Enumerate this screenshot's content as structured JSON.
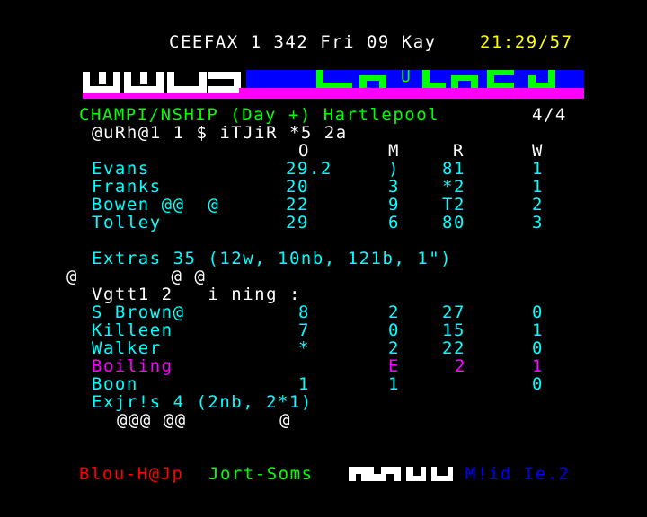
{
  "header": {
    "service": "CEEFAX 1 342 Fri 09 Kay",
    "clock": "21:29/57"
  },
  "banner": {
    "glyph": "U",
    "marker": "I"
  },
  "page": {
    "title": "CHAMPI/NSHIP (Day +) Hartlepool",
    "page_count": "4/4",
    "innings1_heading": "@uRh@1 1 $ iTJiR *5 2a",
    "col_o": "O",
    "col_m": "M",
    "col_r": "R",
    "col_w": "W",
    "bowling1": [
      {
        "name": "Evans",
        "o": "29.2",
        "m": ")",
        "r": "81",
        "w": "1"
      },
      {
        "name": "Franks",
        "o": "20",
        "m": "3",
        "r": "*2",
        "w": "1"
      },
      {
        "name": "Bowen @@  @",
        "o": "22",
        "m": "9",
        "r": "T2",
        "w": "2"
      },
      {
        "name": "Tolley",
        "o": "29",
        "m": "6",
        "r": "80",
        "w": "3"
      }
    ],
    "extras1": "Extras 35 (12w, 10nb, 121b, 1\")",
    "noise_line": "@        @ @",
    "innings2_heading": "Vgtt1 2   i ning :",
    "bowling2": [
      {
        "name": "S Brown@",
        "o": "8",
        "m": "2",
        "r": "27",
        "w": "0",
        "color": "c"
      },
      {
        "name": "Killeen",
        "o": "7",
        "m": "0",
        "r": "15",
        "w": "1",
        "color": "c"
      },
      {
        "name": "Walker",
        "o": "*",
        "m": "2",
        "r": "22",
        "w": "0",
        "color": "c"
      },
      {
        "name": "Boiling",
        "o": "",
        "m": "E",
        "r": "2",
        "w": "1",
        "color": "m"
      },
      {
        "name": "Boon",
        "o": "1",
        "m": "1",
        "r": "",
        "w": "0",
        "color": "c"
      }
    ],
    "extras2": "Exjr!s 4 (2nb, 2*1)",
    "noise_line2": "@@@ @@        @"
  },
  "fastext": {
    "red": "Blou-H@Jp",
    "green": "Jort-Soms",
    "blue": "M!id Ie.2"
  },
  "colors": {
    "white": "#ffffff",
    "yellow": "#ffff00",
    "cyan": "#00ffff",
    "green": "#00ff00",
    "magenta": "#ff00ff",
    "red": "#ff0000",
    "blue": "#0000ff"
  }
}
